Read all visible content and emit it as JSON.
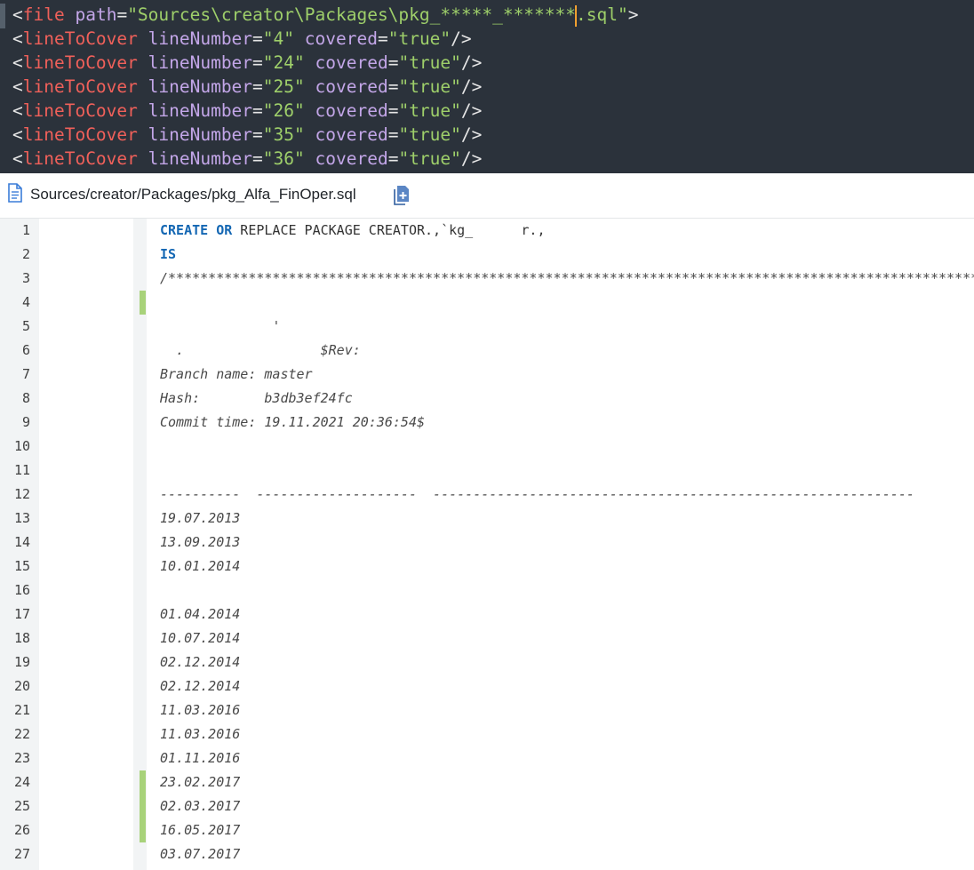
{
  "xml": {
    "file": {
      "open": "<",
      "tag": "file",
      "attr": "path",
      "eq": "=",
      "value_before_caret": "\"Sources\\creator\\Packages\\pkg_*****_*******",
      "value_after_caret": ".sql\"",
      "close": ">"
    },
    "lines": [
      {
        "tag": "lineToCover",
        "attr1": "lineNumber",
        "val1": "\"4\"",
        "attr2": "covered",
        "val2": "\"true\"",
        "end": "/>"
      },
      {
        "tag": "lineToCover",
        "attr1": "lineNumber",
        "val1": "\"24\"",
        "attr2": "covered",
        "val2": "\"true\"",
        "end": "/>"
      },
      {
        "tag": "lineToCover",
        "attr1": "lineNumber",
        "val1": "\"25\"",
        "attr2": "covered",
        "val2": "\"true\"",
        "end": "/>"
      },
      {
        "tag": "lineToCover",
        "attr1": "lineNumber",
        "val1": "\"26\"",
        "attr2": "covered",
        "val2": "\"true\"",
        "end": "/>"
      },
      {
        "tag": "lineToCover",
        "attr1": "lineNumber",
        "val1": "\"35\"",
        "attr2": "covered",
        "val2": "\"true\"",
        "end": "/>"
      },
      {
        "tag": "lineToCover",
        "attr1": "lineNumber",
        "val1": "\"36\"",
        "attr2": "covered",
        "val2": "\"true\"",
        "end": "/>"
      }
    ]
  },
  "file_header": {
    "file_icon": "document-icon",
    "path": "Sources/creator/Packages/pkg_Alfa_FinOper.sql",
    "copy_icon": "copy-file-icon"
  },
  "code": {
    "lines": [
      {
        "n": "1",
        "kw1": "CREATE",
        "kw2": "OR",
        "text": " REPLACE PACKAGE CREATOR.,`kg_      r.,",
        "covered": false
      },
      {
        "n": "2",
        "kw1": "IS",
        "covered": false
      },
      {
        "n": "3",
        "comment": "/*****************************************************************************************************",
        "covered": false
      },
      {
        "n": "4",
        "covered": true
      },
      {
        "n": "5",
        "comment": "              '",
        "covered": false
      },
      {
        "n": "6",
        "comment": "  .                 $Rev:",
        "covered": false
      },
      {
        "n": "7",
        "comment": "Branch name: master",
        "covered": false
      },
      {
        "n": "8",
        "comment": "Hash:        b3db3ef24fc",
        "covered": false
      },
      {
        "n": "9",
        "comment": "Commit time: 19.11.2021 20:36:54$",
        "covered": false
      },
      {
        "n": "10",
        "covered": false
      },
      {
        "n": "11",
        "covered": false
      },
      {
        "n": "12",
        "comment": "----------  --------------------  ------------------------------------------------------------",
        "covered": false
      },
      {
        "n": "13",
        "comment": "19.07.2013",
        "covered": false
      },
      {
        "n": "14",
        "comment": "13.09.2013",
        "covered": false
      },
      {
        "n": "15",
        "comment": "10.01.2014",
        "covered": false
      },
      {
        "n": "16",
        "covered": false
      },
      {
        "n": "17",
        "comment": "01.04.2014",
        "covered": false
      },
      {
        "n": "18",
        "comment": "10.07.2014",
        "covered": false
      },
      {
        "n": "19",
        "comment": "02.12.2014",
        "covered": false
      },
      {
        "n": "20",
        "comment": "02.12.2014",
        "covered": false
      },
      {
        "n": "21",
        "comment": "11.03.2016",
        "covered": false
      },
      {
        "n": "22",
        "comment": "11.03.2016",
        "covered": false
      },
      {
        "n": "23",
        "comment": "01.11.2016",
        "covered": false
      },
      {
        "n": "24",
        "comment": "23.02.2017",
        "covered": true
      },
      {
        "n": "25",
        "comment": "02.03.2017",
        "covered": true
      },
      {
        "n": "26",
        "comment": "16.05.2017",
        "covered": true
      },
      {
        "n": "27",
        "comment": "03.07.2017",
        "covered": false
      }
    ]
  },
  "colors": {
    "xml_background": "#2b323b",
    "xml_tag": "#f0605a",
    "xml_attr": "#c3a6e8",
    "xml_string": "#9ecf6a",
    "caret": "#f0a030",
    "coverage_covered": "#a8d27a",
    "keyword": "#1467b3"
  }
}
